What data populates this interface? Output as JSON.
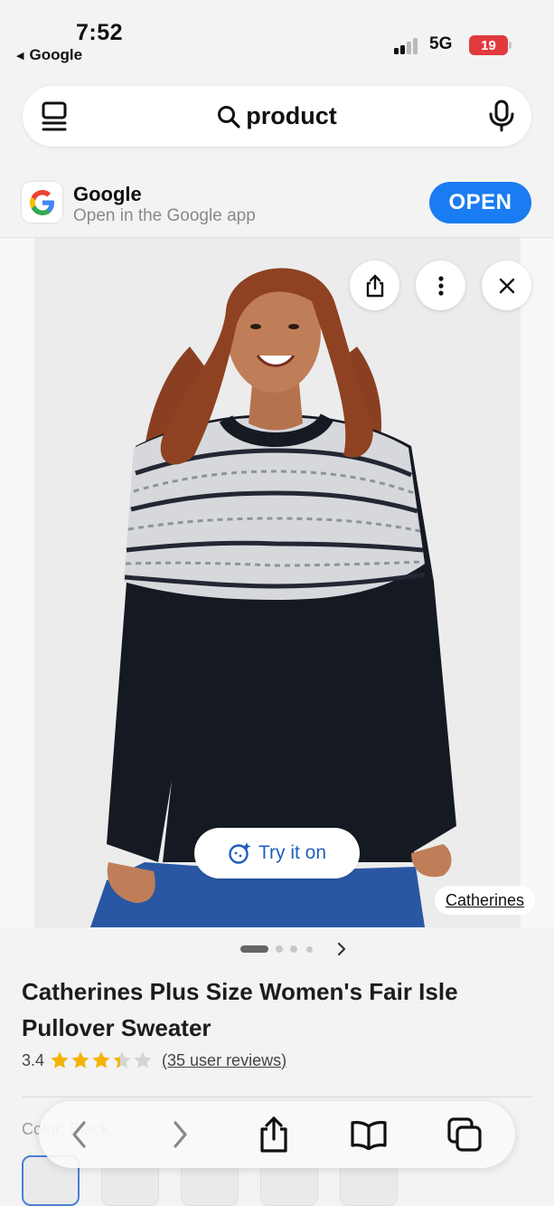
{
  "status_bar": {
    "time": "7:52",
    "back_app": "Google",
    "network": "5G",
    "battery": "19"
  },
  "search": {
    "query": "product"
  },
  "app_banner": {
    "title": "Google",
    "subtitle": "Open in the Google app",
    "open_label": "OPEN"
  },
  "image": {
    "try_on_label": "Try it on",
    "source": "Catherines"
  },
  "pager": {
    "count": 4,
    "active_index": 0
  },
  "product": {
    "title": "Catherines Plus Size Women's Fair Isle Pullover Sweater",
    "rating": "3.4",
    "rating_value": 3.4,
    "review_text": "(35 user reviews)",
    "color_label": "Color: Black"
  },
  "colors": {
    "star": "#f5b301",
    "star_empty": "#d4d4d4",
    "accent": "#1a7cf2",
    "battery": "#e0393e"
  },
  "icons": {
    "tabs": "tabs-icon",
    "search": "search-icon",
    "mic": "mic-icon",
    "share": "share-icon",
    "more": "more-vertical-icon",
    "close": "close-icon",
    "try_on": "sparkle-face-icon",
    "back": "chevron-left-icon",
    "forward": "chevron-right-icon",
    "bookmarks": "book-icon",
    "tab_switcher": "tabs-overview-icon"
  }
}
